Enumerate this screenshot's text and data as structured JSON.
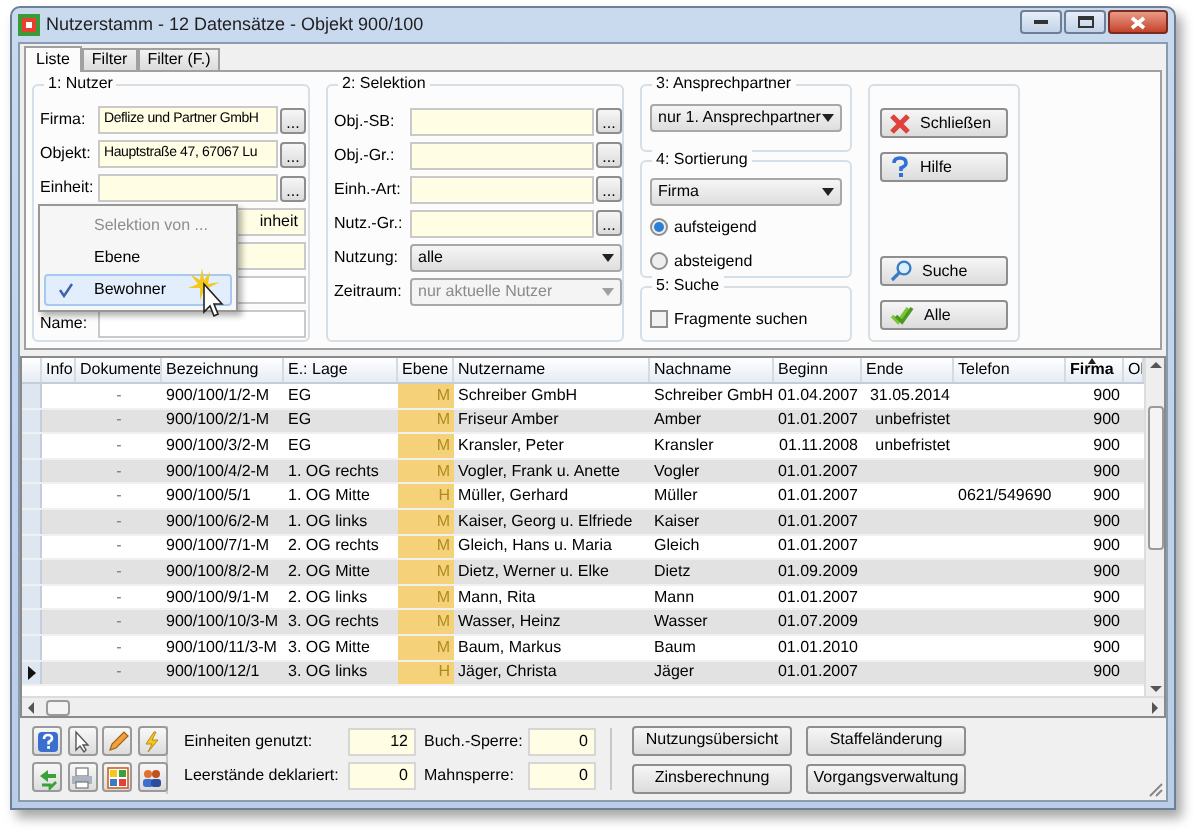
{
  "window": {
    "title": "Nutzerstamm - 12 Datensätze - Objekt 900/100"
  },
  "tabs": [
    {
      "label": "Liste",
      "selected": true
    },
    {
      "label": "Filter",
      "selected": false
    },
    {
      "label": "Filter (F.)",
      "selected": false
    }
  ],
  "nutzer": {
    "title": "1: Nutzer",
    "fields": [
      {
        "kind": "lookup",
        "label": "Firma:",
        "value": "Deflize und Partner GmbH",
        "button": "..."
      },
      {
        "kind": "lookup",
        "label": "Objekt:",
        "value": "Hauptstraße 47, 67067 Lu",
        "button": "..."
      },
      {
        "kind": "lookup",
        "label": "Einheit:",
        "button": "..."
      },
      {
        "kind": "covered_yellow",
        "value": "inheit"
      },
      {
        "kind": "covered_yellow"
      },
      {
        "kind": "covered_white"
      },
      {
        "kind": "plain",
        "label": "Name:"
      }
    ]
  },
  "selection_menu": {
    "items": [
      {
        "label": "Selektion von ...",
        "disabled": true,
        "checked": false,
        "selected": false
      },
      {
        "label": "Ebene",
        "disabled": false,
        "checked": false,
        "selected": false
      },
      {
        "label": "Bewohner",
        "disabled": false,
        "checked": true,
        "selected": true
      }
    ]
  },
  "selektion": {
    "title": "2: Selektion",
    "fields": [
      {
        "kind": "lookup",
        "label": "Obj.-SB:",
        "button": "..."
      },
      {
        "kind": "lookup",
        "label": "Obj.-Gr.:",
        "button": "..."
      },
      {
        "kind": "lookup",
        "label": "Einh.-Art:",
        "button": "..."
      },
      {
        "kind": "lookup",
        "label": "Nutz.-Gr.:",
        "button": "..."
      },
      {
        "kind": "dropdown",
        "label": "Nutzung:",
        "value": "alle",
        "disabled": false
      },
      {
        "kind": "dropdown",
        "label": "Zeitraum:",
        "value": "nur aktuelle Nutzer",
        "disabled": true
      }
    ]
  },
  "ansprechpartner": {
    "title": "3: Ansprechpartner",
    "value": "nur 1. Ansprechpartner"
  },
  "sortierung": {
    "title": "4: Sortierung",
    "value": "Firma",
    "options": [
      {
        "label": "aufsteigend",
        "selected": true
      },
      {
        "label": "absteigend",
        "selected": false
      }
    ]
  },
  "suche": {
    "title": "5: Suche",
    "checkbox": {
      "label": "Fragmente suchen",
      "checked": false
    }
  },
  "actions": [
    {
      "kind": "close",
      "label": "Schließen"
    },
    {
      "kind": "help",
      "label": "Hilfe"
    },
    {
      "kind": "search",
      "label": "Suche"
    },
    {
      "kind": "all",
      "label": "Alle"
    }
  ],
  "table": {
    "columns": [
      {
        "label": "Info",
        "sorted": false
      },
      {
        "label": "Dokumente",
        "sorted": false
      },
      {
        "label": "Bezeichnung",
        "sorted": false
      },
      {
        "label": "E.: Lage",
        "sorted": false
      },
      {
        "label": "Ebene",
        "sorted": false
      },
      {
        "label": "Nutzername",
        "sorted": false
      },
      {
        "label": "Nachname",
        "sorted": false
      },
      {
        "label": "Beginn",
        "sorted": false
      },
      {
        "label": "Ende",
        "sorted": false
      },
      {
        "label": "Telefon",
        "sorted": false
      },
      {
        "label": "Firma",
        "sorted": true
      },
      {
        "label": "Ol",
        "sorted": false
      }
    ],
    "rows": [
      {
        "current": false,
        "cells": [
          "",
          "-",
          "900/100/1/2-M",
          "EG",
          "M",
          "Schreiber GmbH",
          "Schreiber GmbH",
          "01.04.2007",
          "31.05.2014",
          "",
          "900",
          ""
        ]
      },
      {
        "current": false,
        "cells": [
          "",
          "-",
          "900/100/2/1-M",
          "EG",
          "M",
          "Friseur Amber",
          "Amber",
          "01.01.2007",
          "unbefristet",
          "",
          "900",
          ""
        ]
      },
      {
        "current": false,
        "cells": [
          "",
          "-",
          "900/100/3/2-M",
          "EG",
          "M",
          "Kransler, Peter",
          "Kransler",
          "01.11.2008",
          "unbefristet",
          "",
          "900",
          ""
        ]
      },
      {
        "current": false,
        "cells": [
          "",
          "-",
          "900/100/4/2-M",
          "1. OG rechts",
          "M",
          "Vogler, Frank u. Anette",
          "Vogler",
          "01.01.2007",
          "",
          "",
          "900",
          ""
        ]
      },
      {
        "current": false,
        "cells": [
          "",
          "-",
          "900/100/5/1",
          "1. OG Mitte",
          "H",
          "Müller, Gerhard",
          "Müller",
          "01.01.2007",
          "",
          "0621/549690",
          "900",
          ""
        ]
      },
      {
        "current": false,
        "cells": [
          "",
          "-",
          "900/100/6/2-M",
          "1. OG links",
          "M",
          "Kaiser, Georg u. Elfriede",
          "Kaiser",
          "01.01.2007",
          "",
          "",
          "900",
          ""
        ]
      },
      {
        "current": false,
        "cells": [
          "",
          "-",
          "900/100/7/1-M",
          "2. OG rechts",
          "M",
          "Gleich, Hans u. Maria",
          "Gleich",
          "01.01.2007",
          "",
          "",
          "900",
          ""
        ]
      },
      {
        "current": false,
        "cells": [
          "",
          "-",
          "900/100/8/2-M",
          "2. OG Mitte",
          "M",
          "Dietz, Werner u. Elke",
          "Dietz",
          "01.09.2009",
          "",
          "",
          "900",
          ""
        ]
      },
      {
        "current": false,
        "cells": [
          "",
          "-",
          "900/100/9/1-M",
          "2. OG links",
          "M",
          "Mann, Rita",
          "Mann",
          "01.01.2007",
          "",
          "",
          "900",
          ""
        ]
      },
      {
        "current": false,
        "cells": [
          "",
          "-",
          "900/100/10/3-M",
          "3. OG rechts",
          "M",
          "Wasser, Heinz",
          "Wasser",
          "01.07.2009",
          "",
          "",
          "900",
          ""
        ]
      },
      {
        "current": false,
        "cells": [
          "",
          "-",
          "900/100/11/3-M",
          "3. OG Mitte",
          "M",
          "Baum, Markus",
          "Baum",
          "01.01.2010",
          "",
          "",
          "900",
          ""
        ]
      },
      {
        "current": true,
        "cells": [
          "",
          "-",
          "900/100/12/1",
          "3. OG links",
          "H",
          "Jäger, Christa",
          "Jäger",
          "01.01.2007",
          "",
          "",
          "900",
          ""
        ]
      }
    ]
  },
  "stats": [
    {
      "label": "Einheiten genutzt:",
      "value": "12"
    },
    {
      "label": "Buch.-Sperre:",
      "value": "0"
    },
    {
      "label": "Leerstände deklariert:",
      "value": "0"
    },
    {
      "label": "Mahnsperre:",
      "value": "0"
    }
  ],
  "bottom_buttons": [
    "Nutzungsübersicht",
    "Staffeländerung",
    "Zinsberechnung",
    "Vorgangsverwaltung"
  ]
}
